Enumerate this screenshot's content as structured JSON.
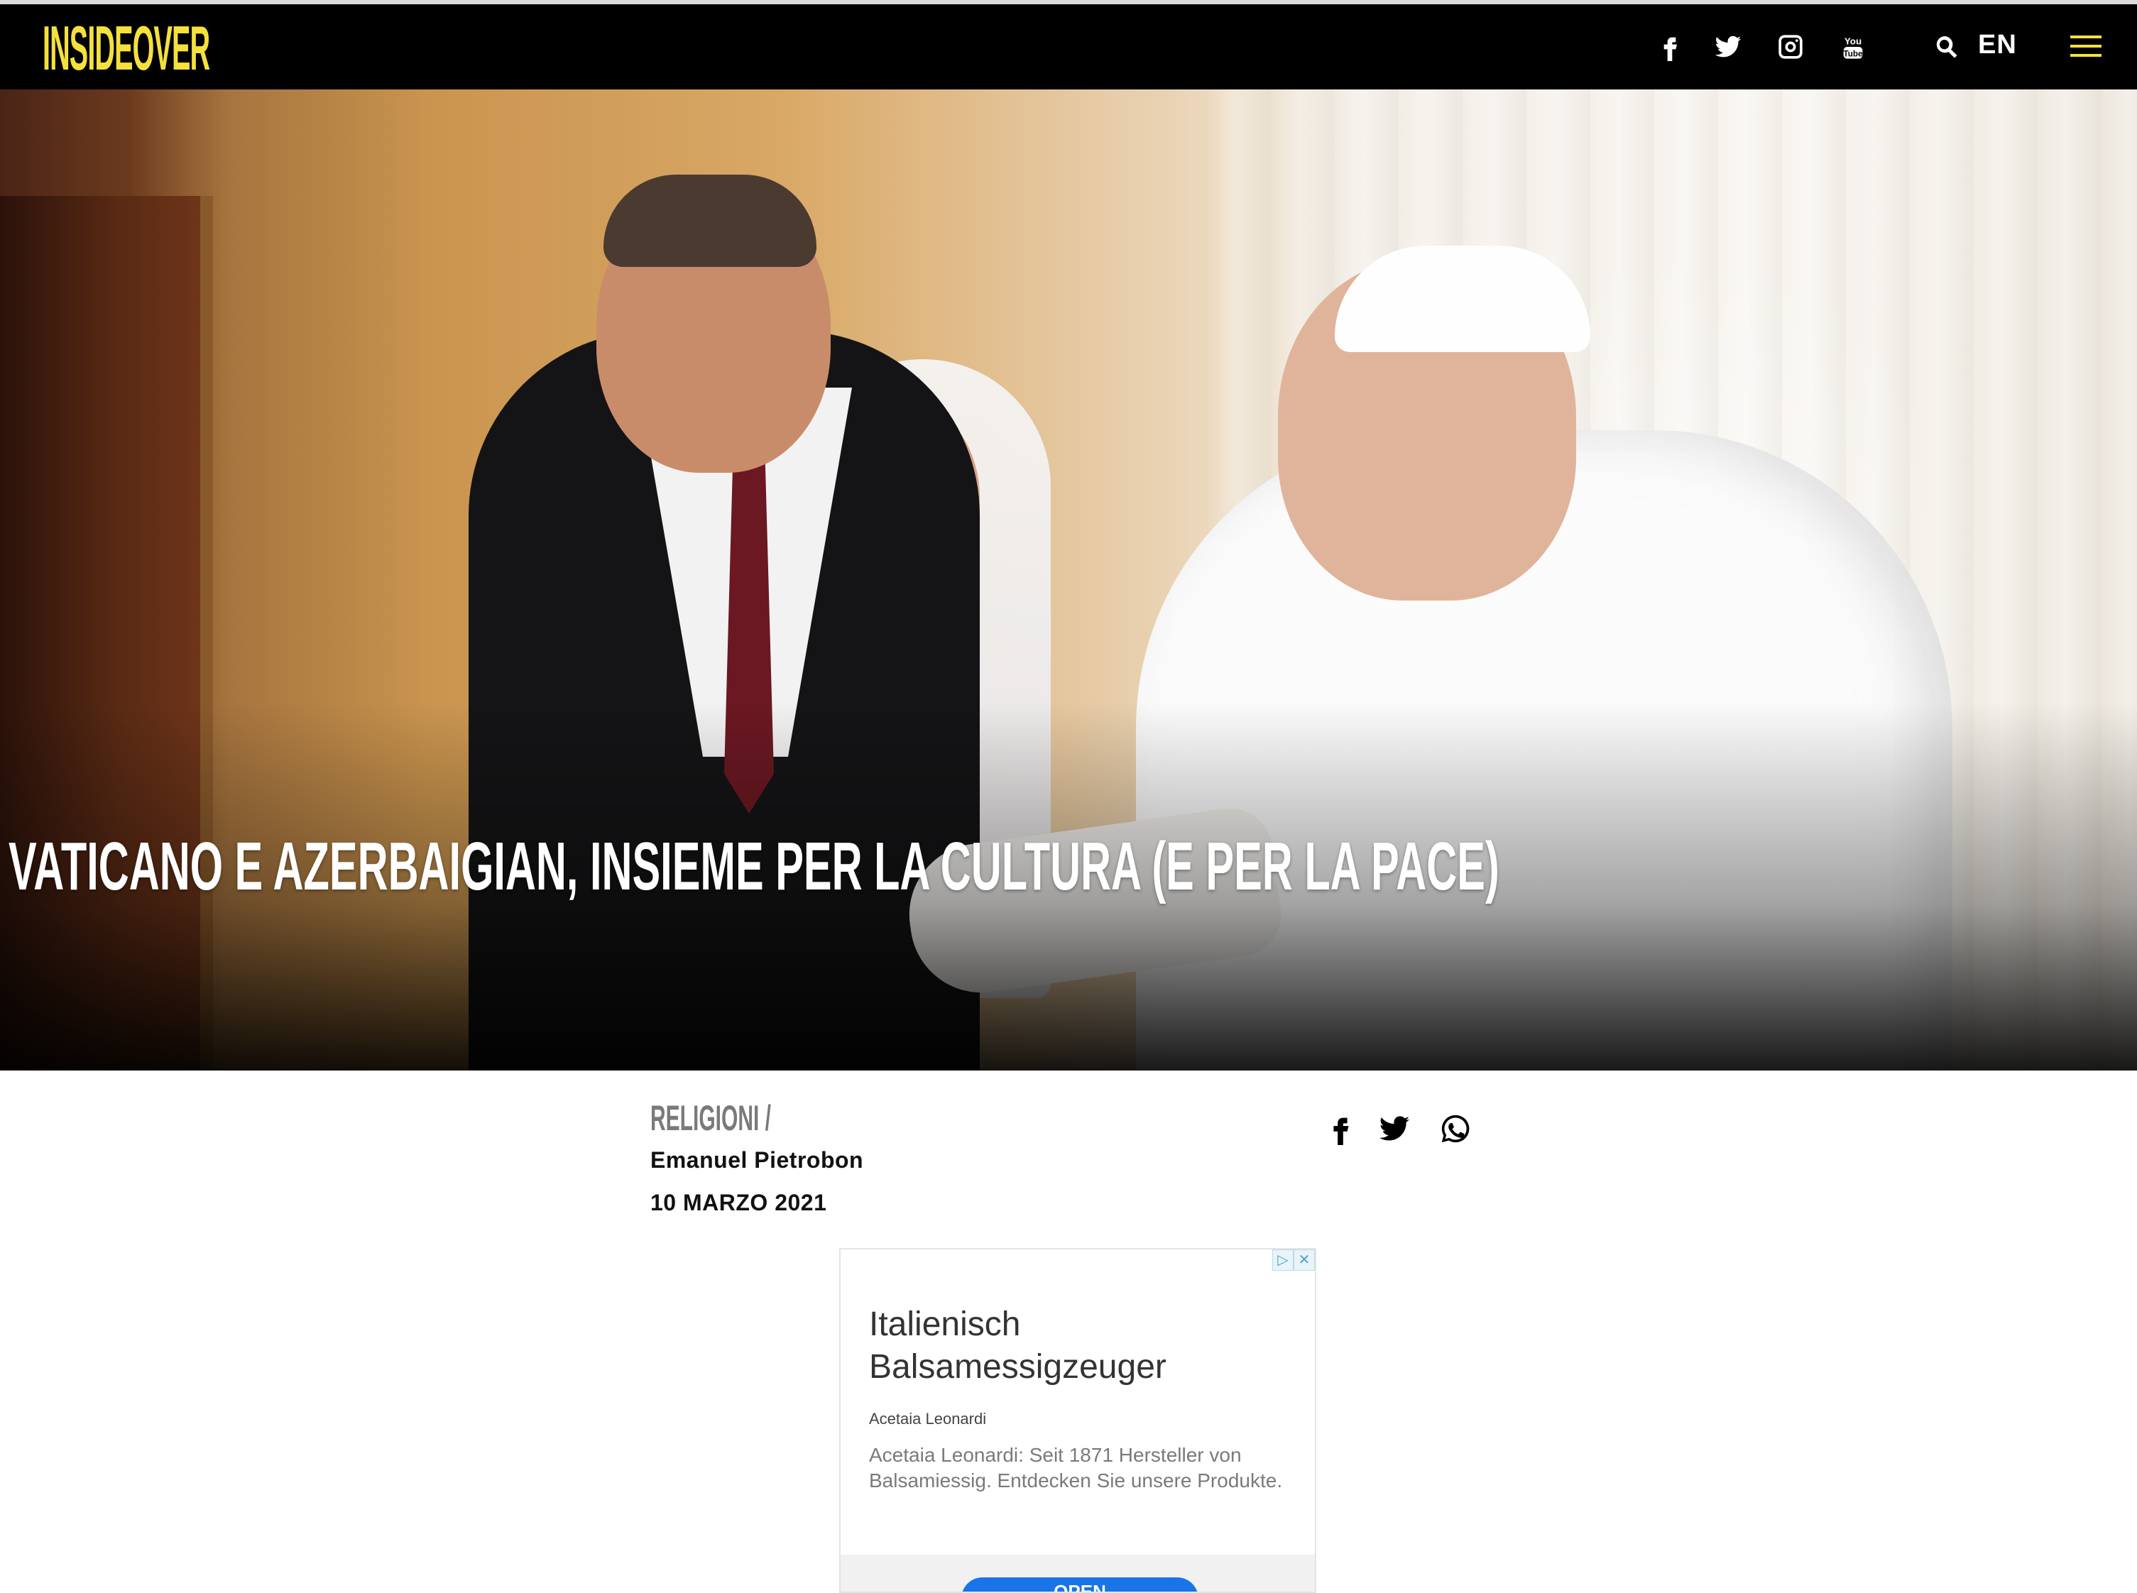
{
  "header": {
    "logo_text": "INSIDEOVER",
    "social_icons": [
      "facebook-icon",
      "twitter-icon",
      "instagram-icon",
      "youtube-icon"
    ],
    "youtube_label": "You Tube",
    "language": "EN",
    "accent_color": "#f4e13c"
  },
  "hero": {
    "title": "Vaticano e Azerbaigian, insieme per la cultura (e per la pace)"
  },
  "article": {
    "category": "RELIGIONI /",
    "author": "Emanuel Pietrobon",
    "date": "10 MARZO 2021",
    "share_icons": [
      "facebook-icon",
      "twitter-icon",
      "whatsapp-icon"
    ]
  },
  "ad": {
    "title": "Italienisch Balsamessigzeuger",
    "advertiser": "Acetaia Leonardi",
    "description": "Acetaia Leonardi: Seit 1871 Hersteller von Balsamiessig. Entdecken Sie unsere Produkte.",
    "cta": "OPEN",
    "choices_icons": [
      "adchoices-icon",
      "close-icon"
    ],
    "choices_glyphs": [
      "▷",
      "✕"
    ]
  }
}
